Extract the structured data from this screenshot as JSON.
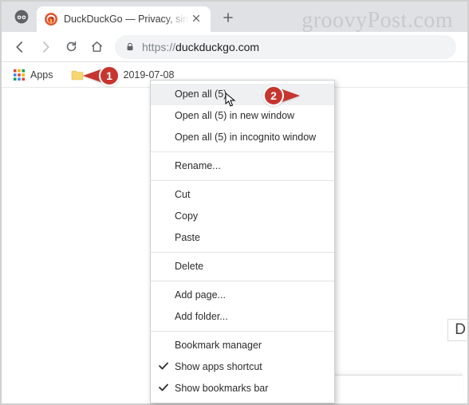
{
  "watermark": "groovyPost.com",
  "tab": {
    "title": "DuckDuckGo — Privacy, simplified."
  },
  "address": {
    "protocol": "https://",
    "host": "duckduckgo.com"
  },
  "bookmarks": {
    "apps_label": "Apps",
    "folder_empty": "",
    "folder_date": "2019-07-08"
  },
  "menu": {
    "open_all": "Open all (5)",
    "open_new_window": "Open all (5) in new window",
    "open_incognito": "Open all (5) in incognito window",
    "rename": "Rename...",
    "cut": "Cut",
    "copy": "Copy",
    "paste": "Paste",
    "delete": "Delete",
    "add_page": "Add page...",
    "add_folder": "Add folder...",
    "bookmark_manager": "Bookmark manager",
    "show_apps": "Show apps shortcut",
    "show_bookmarks": "Show bookmarks bar"
  },
  "callouts": {
    "one": "1",
    "two": "2"
  },
  "side_letter": "D"
}
